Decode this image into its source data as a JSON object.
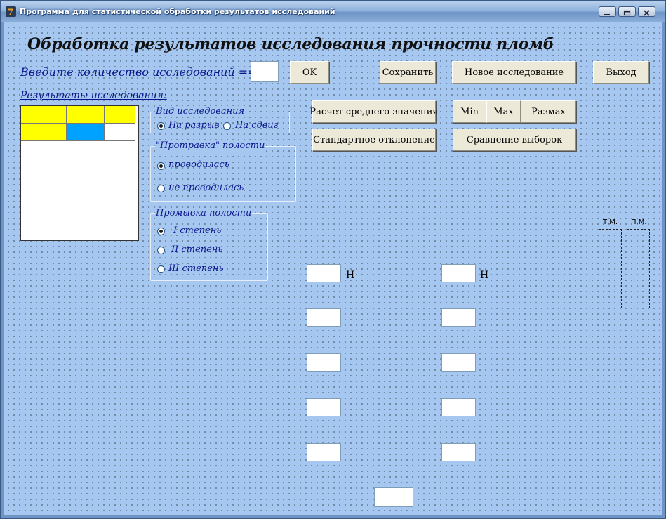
{
  "window": {
    "title": "Программа для статистической обработки результатов исследований",
    "minimize_label": "_",
    "maximize_label": "□",
    "close_label": "×"
  },
  "header": {
    "title": "Обработка результатов исследования прочности пломб"
  },
  "count_prompt": {
    "label": "Введите количество исследований ==>",
    "value": ""
  },
  "buttons": {
    "ok": "OK",
    "save": "Сохранить",
    "new_study": "Новое исследование",
    "exit": "Выход",
    "mean": "Расчет среднего значения",
    "min": "Min",
    "max": "Max",
    "range": "Размах",
    "std_dev": "Стандартное отклонение",
    "compare": "Сравнение выборок"
  },
  "results": {
    "label": "Результаты исследования:"
  },
  "study_type": {
    "title": "Вид исследования",
    "options": [
      {
        "label": "На разрыв",
        "selected": true
      },
      {
        "label": "На сдвиг",
        "selected": false
      }
    ]
  },
  "etching": {
    "title": "\"Протравка\" полости",
    "options": [
      {
        "label": "проводилась",
        "selected": true
      },
      {
        "label": "не проводилась",
        "selected": false
      }
    ]
  },
  "washing": {
    "title": "Промывка полости",
    "options": [
      {
        "label": "I степень",
        "selected": true
      },
      {
        "label": "II степень",
        "selected": false
      },
      {
        "label": "III степень",
        "selected": false
      }
    ]
  },
  "units": {
    "left": "Н",
    "right": "Н"
  },
  "diagram": {
    "left_label": "Т.М.",
    "right_label": "П.М."
  },
  "colors": {
    "client_bg": "#a6c8f0",
    "grid_yellow": "#ffff00",
    "grid_selected": "#00a2ff",
    "label_blue": "#0b158c"
  }
}
